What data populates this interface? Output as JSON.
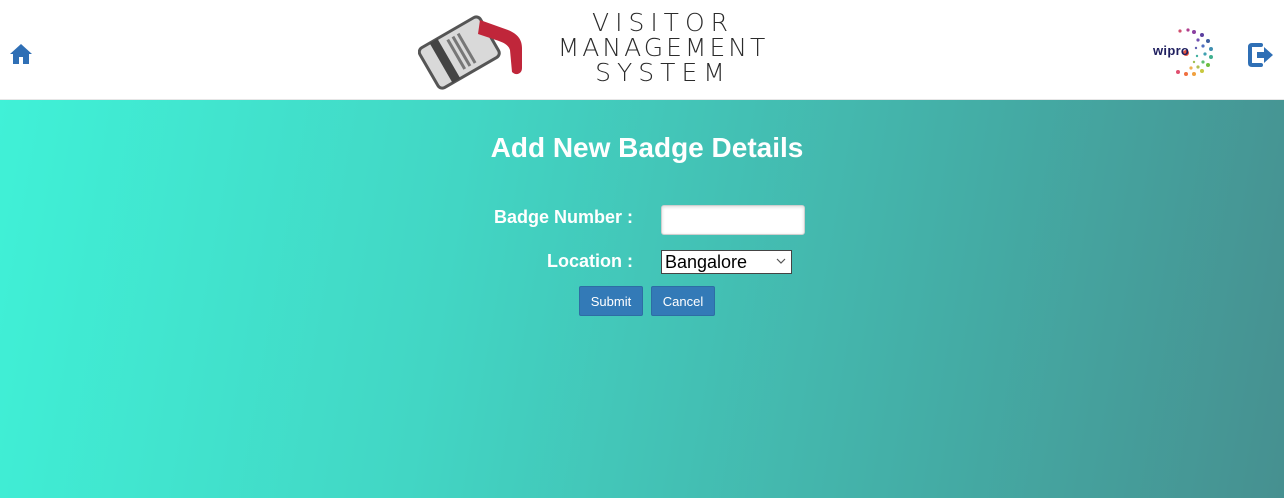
{
  "header": {
    "app_title_lines": [
      "VISITOR",
      "MANAGEMENT",
      "SYSTEM"
    ],
    "partner_logo_text": "wipro",
    "home_icon": "home-icon",
    "logout_icon": "logout-icon"
  },
  "form": {
    "title": "Add New Badge Details",
    "badge_number_label": "Badge Number :",
    "badge_number_value": "",
    "location_label": "Location :",
    "location_selected": "Bangalore",
    "submit_label": "Submit",
    "cancel_label": "Cancel"
  },
  "colors": {
    "button_primary": "#337ab7",
    "home_icon": "#2f6fb5",
    "logo_red": "#c0263a",
    "background_start": "#40f1d7",
    "background_end": "#469090"
  }
}
